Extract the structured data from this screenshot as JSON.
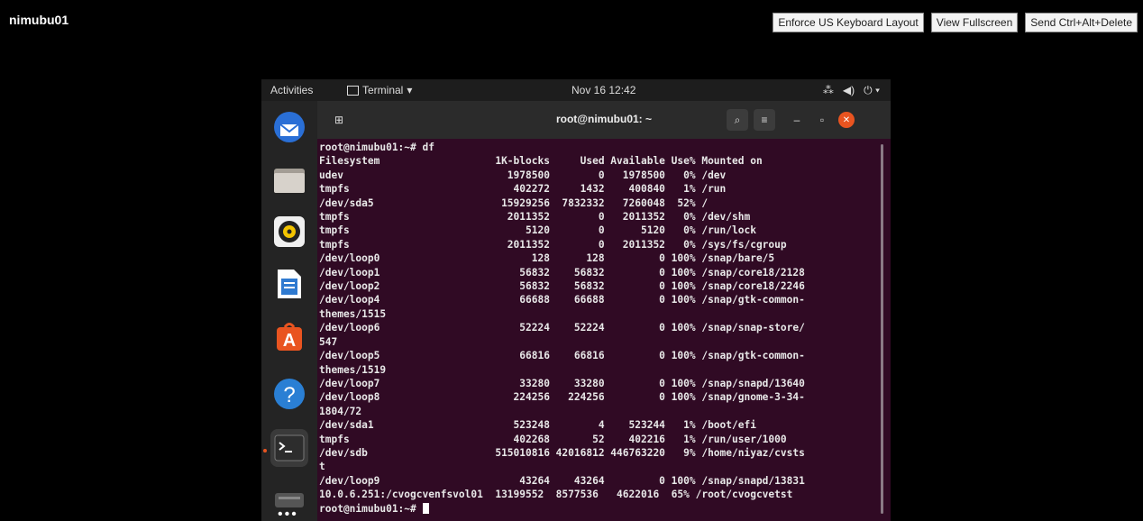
{
  "host": {
    "name": "nimubu01"
  },
  "toolbar": {
    "buttons": [
      "Enforce US Keyboard Layout",
      "View Fullscreen",
      "Send Ctrl+Alt+Delete"
    ]
  },
  "gnome": {
    "activities": "Activities",
    "app_menu": "Terminal",
    "clock": "Nov 16  12:42"
  },
  "terminal": {
    "title": "root@nimubu01: ~",
    "lines": [
      "root@nimubu01:~# df",
      "Filesystem                   1K-blocks     Used Available Use% Mounted on",
      "udev                           1978500        0   1978500   0% /dev",
      "tmpfs                           402272     1432    400840   1% /run",
      "/dev/sda5                     15929256  7832332   7260048  52% /",
      "tmpfs                          2011352        0   2011352   0% /dev/shm",
      "tmpfs                             5120        0      5120   0% /run/lock",
      "tmpfs                          2011352        0   2011352   0% /sys/fs/cgroup",
      "/dev/loop0                         128      128         0 100% /snap/bare/5",
      "/dev/loop1                       56832    56832         0 100% /snap/core18/2128",
      "/dev/loop2                       56832    56832         0 100% /snap/core18/2246",
      "/dev/loop4                       66688    66688         0 100% /snap/gtk-common-",
      "themes/1515",
      "/dev/loop6                       52224    52224         0 100% /snap/snap-store/",
      "547",
      "/dev/loop5                       66816    66816         0 100% /snap/gtk-common-",
      "themes/1519",
      "/dev/loop7                       33280    33280         0 100% /snap/snapd/13640",
      "/dev/loop8                      224256   224256         0 100% /snap/gnome-3-34-",
      "1804/72",
      "/dev/sda1                       523248        4    523244   1% /boot/efi",
      "tmpfs                           402268       52    402216   1% /run/user/1000",
      "/dev/sdb                     515010816 42016812 446763220   9% /home/niyaz/cvsts",
      "t",
      "/dev/loop9                       43264    43264         0 100% /snap/snapd/13831",
      "10.0.6.251:/cvogcvenfsvol01  13199552  8577536   4622016  65% /root/cvogcvetst"
    ],
    "prompt": "root@nimubu01:~# "
  }
}
